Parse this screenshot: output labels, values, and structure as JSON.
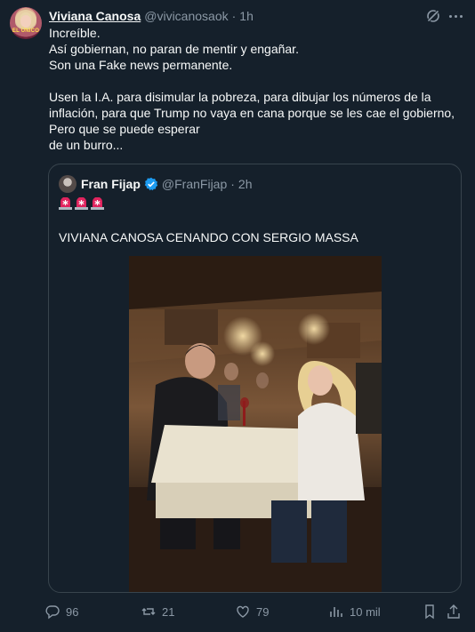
{
  "tweet": {
    "author_name": "Viviana Canosa",
    "author_handle": "@vivicanosaok",
    "separator": "·",
    "time": "1h",
    "avatar_text": "EL ÚNICO",
    "lines": [
      "Increíble.",
      "Así gobiernan, no paran de mentir y engañar.",
      "Son  una Fake news permanente.",
      "",
      "Usen la I.A. para disimular la pobreza, para dibujar los números de la",
      "inflación, para que Trump no vaya en cana porque se les cae el gobierno,",
      "Pero que se puede esperar",
      "de un burro..."
    ]
  },
  "quote": {
    "author_name": "Fran Fijap",
    "author_handle": "@FranFijap",
    "separator": "·",
    "time": "2h",
    "emoji": [
      "siren-icon",
      "siren-icon",
      "siren-icon"
    ],
    "text": "VIVIANA CANOSA CENANDO CON SERGIO MASSA"
  },
  "actions": {
    "replies": "96",
    "reposts": "21",
    "likes": "79",
    "views": "10 mil"
  },
  "colors": {
    "background": "#15202b",
    "text": "#f7f9f9",
    "muted": "#8b98a5",
    "border": "#38444d",
    "verified": "#1d9bf0",
    "siren": "#e0245e"
  }
}
